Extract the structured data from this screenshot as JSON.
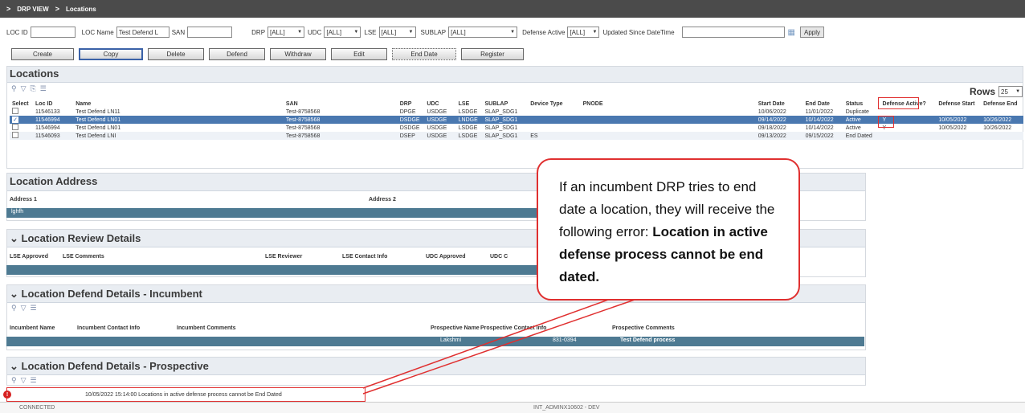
{
  "breadcrumb": {
    "root": "DRP VIEW",
    "current": "Locations"
  },
  "filters": {
    "loc_id_label": "LOC ID",
    "loc_id_value": "",
    "loc_name_label": "LOC Name",
    "loc_name_value": "Test Defend L",
    "san_label": "SAN",
    "san_value": "",
    "drp_label": "DRP",
    "drp_value": "[ALL]",
    "udc_label": "UDC",
    "udc_value": "[ALL]",
    "lse_label": "LSE",
    "lse_value": "[ALL]",
    "sublap_label": "SUBLAP",
    "sublap_value": "[ALL]",
    "defense_active_label": "Defense Active",
    "defense_active_value": "[ALL]",
    "updated_since_label": "Updated Since DateTime",
    "updated_since_value": "",
    "apply_label": "Apply"
  },
  "actions": [
    "Create",
    "Copy",
    "Delete",
    "Defend",
    "Withdraw",
    "Edit",
    "End Date",
    "Register"
  ],
  "locations": {
    "title": "Locations",
    "rows_label": "Rows",
    "rows_value": "25",
    "columns": [
      "Select",
      "Loc ID",
      "Name",
      "SAN",
      "DRP",
      "UDC",
      "LSE",
      "SUBLAP",
      "Device Type",
      "PNODE",
      "Start Date",
      "End Date",
      "Status",
      "Defense Active?",
      "Defense Start",
      "Defense End"
    ],
    "rows": [
      {
        "loc_id": "11546133",
        "name": "Test Defend LN11",
        "san": "Test-8758568",
        "drp": "DPGE",
        "udc": "USDGE",
        "lse": "LSDGE",
        "sublap": "SLAP_SDG1",
        "device": "",
        "pnode": "",
        "start": "10/06/2022",
        "end": "11/01/2022",
        "status": "Duplicate",
        "def_active": "",
        "def_start": "",
        "def_end": ""
      },
      {
        "loc_id": "11546994",
        "name": "Test Defend LN01",
        "san": "Test-8758568",
        "drp": "DSDGE",
        "udc": "USDGE",
        "lse": "LNDGE",
        "sublap": "SLAP_SDG1",
        "device": "",
        "pnode": "",
        "start": "09/14/2022",
        "end": "10/14/2022",
        "status": "Active",
        "def_active": "Y",
        "def_start": "10/05/2022",
        "def_end": "10/26/2022"
      },
      {
        "loc_id": "11546994",
        "name": "Test Defend LN01",
        "san": "Test-8758568",
        "drp": "DSDGE",
        "udc": "USDGE",
        "lse": "LSDGE",
        "sublap": "SLAP_SDG1",
        "device": "",
        "pnode": "",
        "start": "09/18/2022",
        "end": "10/14/2022",
        "status": "Active",
        "def_active": "Y",
        "def_start": "10/05/2022",
        "def_end": "10/26/2022"
      },
      {
        "loc_id": "11546093",
        "name": "Test Defend LNI",
        "san": "Test-8758568",
        "drp": "DSEP",
        "udc": "USDGE",
        "lse": "LSDGE",
        "sublap": "SLAP_SDG1",
        "device": "ES",
        "pnode": "",
        "start": "09/13/2022",
        "end": "09/15/2022",
        "status": "End Dated",
        "def_active": "",
        "def_start": "",
        "def_end": ""
      }
    ]
  },
  "address": {
    "title": "Location Address",
    "col1": "Address 1",
    "col2": "Address 2",
    "value1": "lghfh"
  },
  "review": {
    "title": "Location Review Details",
    "columns": [
      "LSE Approved",
      "LSE Comments",
      "LSE Reviewer",
      "LSE Contact Info",
      "UDC Approved",
      "UDC C"
    ]
  },
  "incumbent": {
    "title": "Location Defend Details - Incumbent",
    "columns": [
      "Incumbent Name",
      "Incumbent Contact Info",
      "Incumbent Comments",
      "Prospective Name",
      "Prospective Contact Info",
      "Prospective Comments"
    ],
    "row": {
      "prospective_name": "Lakshmi",
      "prospective_contact": "831-0394",
      "prospective_comments": "Test Defend process"
    }
  },
  "prospective": {
    "title": "Location Defend Details - Prospective"
  },
  "error_message": "10/05/2022 15:14:00 Locations in active defense process cannot be End Dated",
  "status_bar": {
    "connection": "CONNECTED",
    "user": "INT_ADMINX10602 - DEV"
  },
  "callout": {
    "line1": "If an incumbent DRP tries to end date a location, they will receive the following error: ",
    "bold": "Location in active defense process cannot be end dated."
  }
}
